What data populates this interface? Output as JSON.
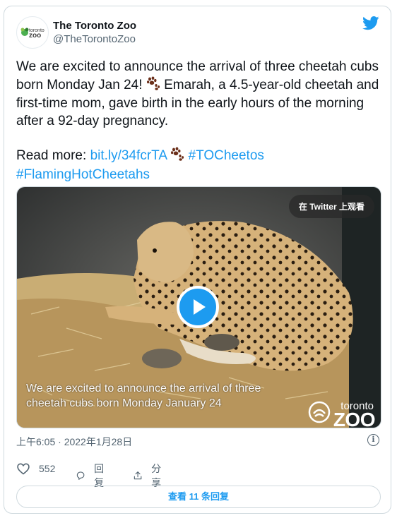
{
  "author": {
    "name": "The Toronto Zoo",
    "handle": "@TheTorontoZoo",
    "logo_text": [
      "toronto",
      "zoo"
    ]
  },
  "tweet": {
    "paragraph1_before_paw": "We are excited to announce the arrival of three cheetah cubs born Monday Jan 24!",
    "paragraph1_after_paw": "Emarah, a 4.5-year-old cheetah and first-time mom, gave birth in the early hours of the morning after a 92-day pregnancy.",
    "read_more_label": "Read more:",
    "link": "bit.ly/34fcrTA",
    "hashtag1": "#TOCheetos",
    "hashtag2": "#FlamingHotCheetahs"
  },
  "media": {
    "watch_on_twitter": "在 Twitter 上观看",
    "caption_line1": "We are excited to announce the arrival of three",
    "caption_line2": "cheetah cubs born Monday January 24",
    "watermark_top": "toronto",
    "watermark_bottom": "ZOO"
  },
  "timestamp": "上午6:05 · 2022年1月28日",
  "actions": {
    "likes": "552",
    "reply_label": "回复",
    "share_label": "分享"
  },
  "view_replies": "查看 11 条回复",
  "colors": {
    "accent": "#1d9bf0",
    "text": "#0f1419",
    "muted": "#536471",
    "paw": "#6b2f1a"
  },
  "icons": [
    "twitter-bird-icon",
    "paw-prints-icon",
    "play-icon",
    "info-icon",
    "heart-icon",
    "reply-icon",
    "share-icon"
  ]
}
